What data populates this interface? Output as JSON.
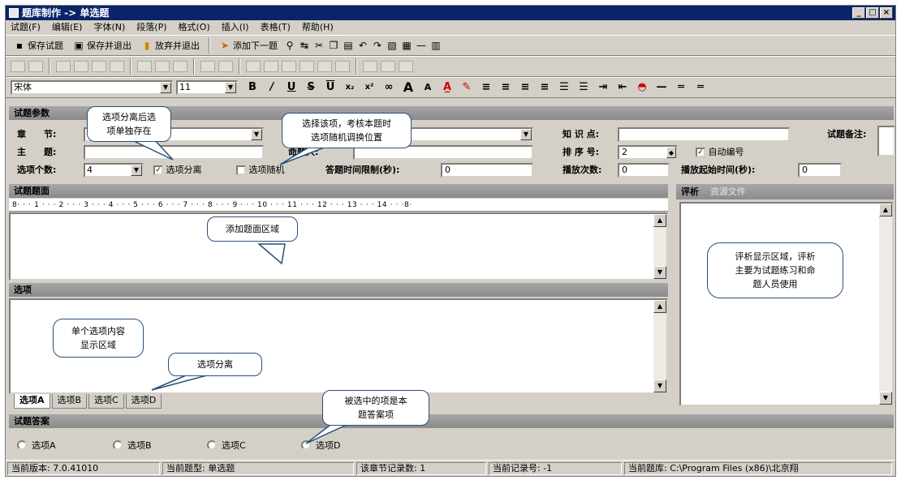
{
  "window": {
    "title": "题库制作 -> 单选题",
    "controls": [
      "_",
      "□",
      "×"
    ]
  },
  "menu": [
    "试题(F)",
    "编辑(E)",
    "字体(N)",
    "段落(P)",
    "格式(O)",
    "插入(I)",
    "表格(T)",
    "帮助(H)"
  ],
  "toolbar": {
    "save": "保存试题",
    "save_exit": "保存并退出",
    "discard_exit": "放弃并退出",
    "add_next": "添加下一题"
  },
  "format": {
    "font": "宋体",
    "size": "11",
    "colors": {
      "font_color_bar": "#d40000",
      "highlight_bar": "#d40000"
    }
  },
  "params": {
    "header": "试题参数",
    "chapter_label": "章　　节:",
    "subject_label": "主　　题:",
    "creator_label": "命题人:",
    "knowledge_label": "知 识 点:",
    "sort_label": "排 序 号:",
    "sort_value": "2",
    "auto_number_label": "自动编号",
    "remark_label": "试题备注:",
    "option_count_label": "选项个数:",
    "option_count_value": "4",
    "separate_label": "选项分离",
    "random_label": "选项随机",
    "time_limit_label": "答题时间限制(秒):",
    "time_limit_value": "0",
    "play_count_label": "播放次数:",
    "play_count_value": "0",
    "play_start_label": "播放起始时间(秒):",
    "play_start_value": "0"
  },
  "stem": {
    "header": "试题题面",
    "ruler": "8· · · 1 · · · 2 · · · 3 · · · 4 · · · 5 · · · 6 · · · 7 · · · 8 · · · 9 · · · 10 · · · 11 · · · 12 · · · 13 · · · 14 · · ·8·"
  },
  "analysis": {
    "tab_analysis": "评析",
    "tab_resources": "资源文件"
  },
  "options": {
    "header": "选项",
    "tabs": [
      "选项A",
      "选项B",
      "选项C",
      "选项D"
    ]
  },
  "answer": {
    "header": "试题答案",
    "choices": [
      "选项A",
      "选项B",
      "选项C",
      "选项D"
    ]
  },
  "status": {
    "version": "当前版本: 7.0.41010",
    "type": "当前题型: 单选题",
    "section_count": "该章节记录数: 1",
    "record_no": "当前记录号: -1",
    "bank": "当前题库: C:\\Program Files (x86)\\北京翔"
  },
  "callouts": {
    "separate": [
      "选项分离后选",
      "项单独存在"
    ],
    "random": [
      "选择该项，考核本题时",
      "选项随机调换位置"
    ],
    "stem_area": "添加题面区域",
    "analysis_area": [
      "评析显示区域，评析",
      "主要为试题练习和命",
      "题人员使用"
    ],
    "single_option": [
      "单个选项内容",
      "显示区域"
    ],
    "option_separate": "选项分离",
    "selected_answer": [
      "被选中的项是本",
      "题答案项"
    ]
  }
}
